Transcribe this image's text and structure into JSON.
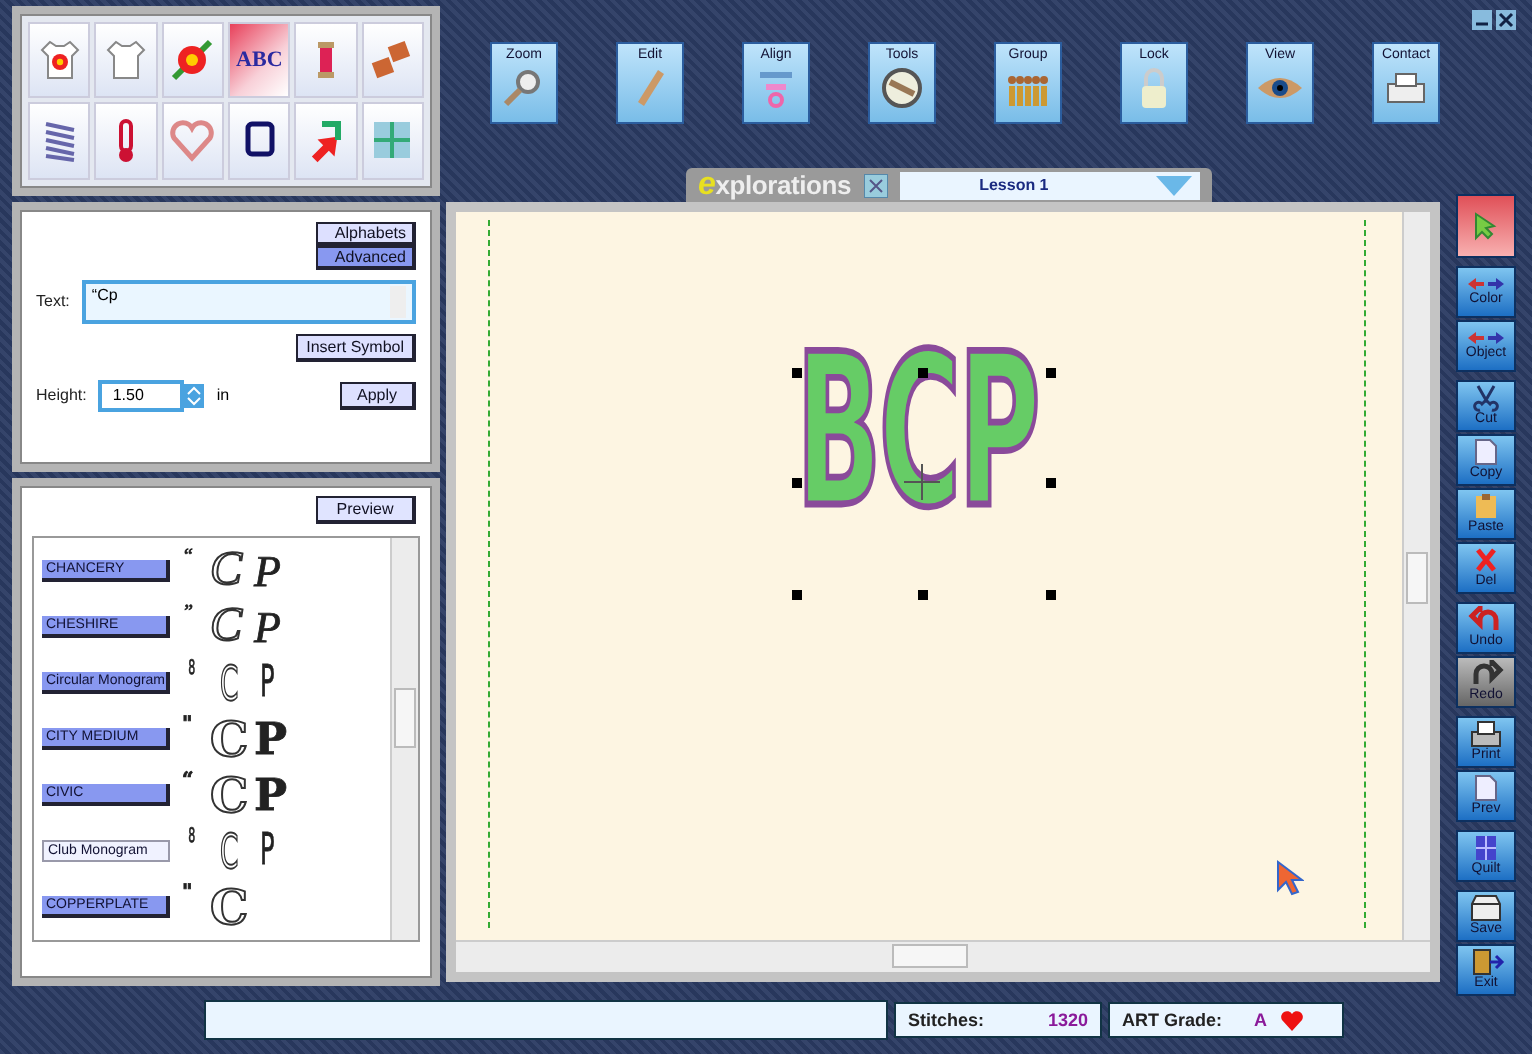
{
  "palette": [
    {
      "kind": "shirt-flower",
      "selected": false
    },
    {
      "kind": "shirt",
      "selected": false
    },
    {
      "kind": "flower",
      "selected": false
    },
    {
      "kind": "letters",
      "label": "ABC",
      "selected": true
    },
    {
      "kind": "thread",
      "selected": false
    },
    {
      "kind": "swatches",
      "selected": false
    },
    {
      "kind": "spring",
      "selected": false
    },
    {
      "kind": "thermometer",
      "selected": false
    },
    {
      "kind": "heart",
      "selected": false
    },
    {
      "kind": "frame",
      "selected": false
    },
    {
      "kind": "arrows",
      "selected": false
    },
    {
      "kind": "grid",
      "selected": false
    }
  ],
  "toolbar": [
    {
      "label": "Zoom",
      "kind": "magnifier"
    },
    {
      "label": "Edit",
      "kind": "pencil"
    },
    {
      "label": "Align",
      "kind": "align"
    },
    {
      "label": "Tools",
      "kind": "dial"
    },
    {
      "label": "Group",
      "kind": "people"
    },
    {
      "label": "Lock",
      "kind": "lock"
    },
    {
      "label": "View",
      "kind": "eye"
    },
    {
      "label": "Contact",
      "kind": "printer"
    }
  ],
  "text_panel": {
    "modes": [
      {
        "label": "Alphabets",
        "selected": false
      },
      {
        "label": "Advanced",
        "selected": true
      }
    ],
    "text_label": "Text:",
    "text_value": "“Cp",
    "insert_symbol": "Insert Symbol",
    "height_label": "Height:",
    "height_value": "1.50",
    "unit": "in",
    "apply": "Apply"
  },
  "fonts_panel": {
    "preview": "Preview",
    "fonts": [
      {
        "name": "CHANCERY",
        "kind": "script",
        "glyphs": [
          "“",
          "C",
          "P"
        ],
        "selected": false
      },
      {
        "name": "CHESHIRE",
        "kind": "script",
        "glyphs": [
          "”",
          "C",
          "P"
        ],
        "selected": false
      },
      {
        "name": "Circular Monogram",
        "kind": "condensed",
        "glyphs": [
          "8",
          "C",
          "P"
        ],
        "selected": false
      },
      {
        "name": "CITY MEDIUM",
        "kind": "block",
        "glyphs": [
          "\"",
          "C",
          "P"
        ],
        "selected": false
      },
      {
        "name": "CIVIC",
        "kind": "block",
        "glyphs": [
          "“",
          "C",
          "P"
        ],
        "selected": false
      },
      {
        "name": "Club Monogram",
        "kind": "condensed",
        "glyphs": [
          "8",
          "C",
          "P"
        ],
        "selected": true
      },
      {
        "name": "COPPERPLATE",
        "kind": "block",
        "glyphs": [
          "\"",
          "C"
        ],
        "selected": false
      }
    ]
  },
  "lesson_tab": {
    "logo": "explorations",
    "lesson": "Lesson 1"
  },
  "canvas": {
    "design_text": "BCP"
  },
  "side_tools": [
    [
      {
        "kind": "pointer",
        "disabled": false
      }
    ],
    [
      {
        "label": "Color",
        "kind": "swap",
        "disabled": false
      },
      {
        "label": "Object",
        "kind": "swap",
        "disabled": false
      }
    ],
    [
      {
        "label": "Cut",
        "kind": "scissors",
        "disabled": false
      },
      {
        "label": "Copy",
        "kind": "page",
        "disabled": false
      },
      {
        "label": "Paste",
        "kind": "clipboard",
        "disabled": false
      },
      {
        "label": "Del",
        "kind": "cross",
        "disabled": false
      }
    ],
    [
      {
        "label": "Undo",
        "kind": "undo",
        "disabled": false
      },
      {
        "label": "Redo",
        "kind": "redo",
        "disabled": true
      }
    ],
    [
      {
        "label": "Print",
        "kind": "printer",
        "disabled": false
      },
      {
        "label": "Prev",
        "kind": "page",
        "disabled": false
      }
    ],
    [
      {
        "label": "Quilt",
        "kind": "grid",
        "disabled": false
      }
    ],
    [
      {
        "label": "Save",
        "kind": "tray",
        "disabled": false
      },
      {
        "label": "Exit",
        "kind": "door",
        "disabled": false
      }
    ]
  ],
  "status_bar": {
    "stitches_label": "Stitches:",
    "stitches": "1320",
    "grade_label": "ART Grade:",
    "grade": "A"
  }
}
